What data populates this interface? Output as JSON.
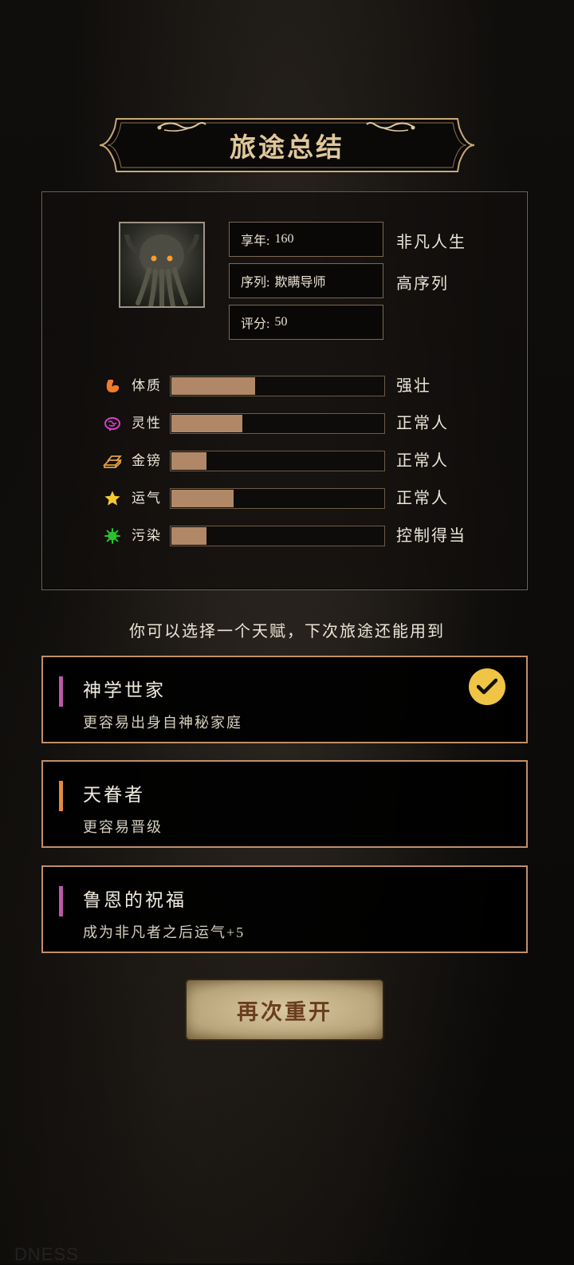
{
  "title": "旅途总结",
  "summary": {
    "info": [
      {
        "key": "享年:",
        "value": "160",
        "tag": "非凡人生"
      },
      {
        "key": "序列:",
        "value": "欺瞒导师",
        "tag": "高序列"
      },
      {
        "key": "评分:",
        "value": "50",
        "tag": ""
      }
    ],
    "stats": [
      {
        "icon": "muscle-icon",
        "label": "体质",
        "fill": 0.4,
        "desc": "强壮",
        "color": "#f07c2a"
      },
      {
        "icon": "brain-icon",
        "label": "灵性",
        "fill": 0.34,
        "desc": "正常人",
        "color": "#d940c0"
      },
      {
        "icon": "gold-bars-icon",
        "label": "金镑",
        "fill": 0.17,
        "desc": "正常人",
        "color": "#e0a040"
      },
      {
        "icon": "star-icon",
        "label": "运气",
        "fill": 0.3,
        "desc": "正常人",
        "color": "#f5c92f"
      },
      {
        "icon": "virus-icon",
        "label": "污染",
        "fill": 0.17,
        "desc": "控制得当",
        "color": "#29c22f"
      }
    ]
  },
  "prompt": "你可以选择一个天赋，下次旅途还能用到",
  "talents": [
    {
      "name": "神学世家",
      "desc": "更容易出身自神秘家庭",
      "accent": "#b85aa8",
      "selected": true
    },
    {
      "name": "天眷者",
      "desc": "更容易晋级",
      "accent": "#e08a44",
      "selected": false
    },
    {
      "name": "鲁恩的祝福",
      "desc": "成为非凡者之后运气+5",
      "accent": "#b85aa8",
      "selected": false
    }
  ],
  "restart_label": "再次重开",
  "watermark": "DNESS"
}
